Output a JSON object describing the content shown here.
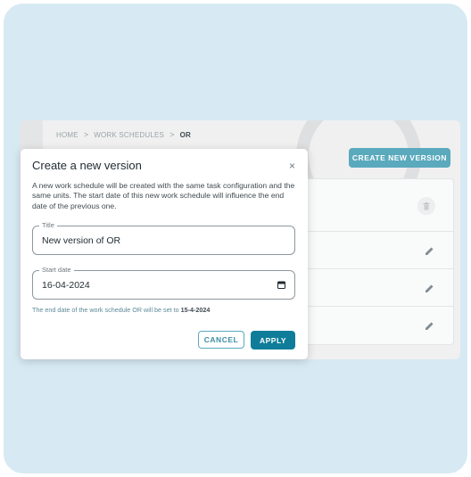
{
  "breadcrumb": {
    "home": "HOME",
    "schedules": "WORK SCHEDULES",
    "current": "OR",
    "separator": ">"
  },
  "page": {
    "create_button": "CREATE NEW VERSION",
    "accent_color": "#5aa9bd"
  },
  "table": {
    "row_actions": [
      "delete-icon",
      "edit-icon",
      "edit-icon",
      "edit-icon"
    ]
  },
  "dialog": {
    "title": "Create a new version",
    "close": "×",
    "description": "A new work schedule will be created with the same task configuration and the same units. The start date of this new work schedule will influence the end date of the previous one.",
    "title_field": {
      "label": "Title",
      "value": "New version of OR"
    },
    "start_date_field": {
      "label": "Start date",
      "value": "16-04-2024"
    },
    "hint_prefix": "The end date of the work schedule OR will be set to",
    "hint_date": "15-4-2024",
    "cancel_label": "CANCEL",
    "apply_label": "APPLY",
    "primary_color": "#0f7d99"
  }
}
